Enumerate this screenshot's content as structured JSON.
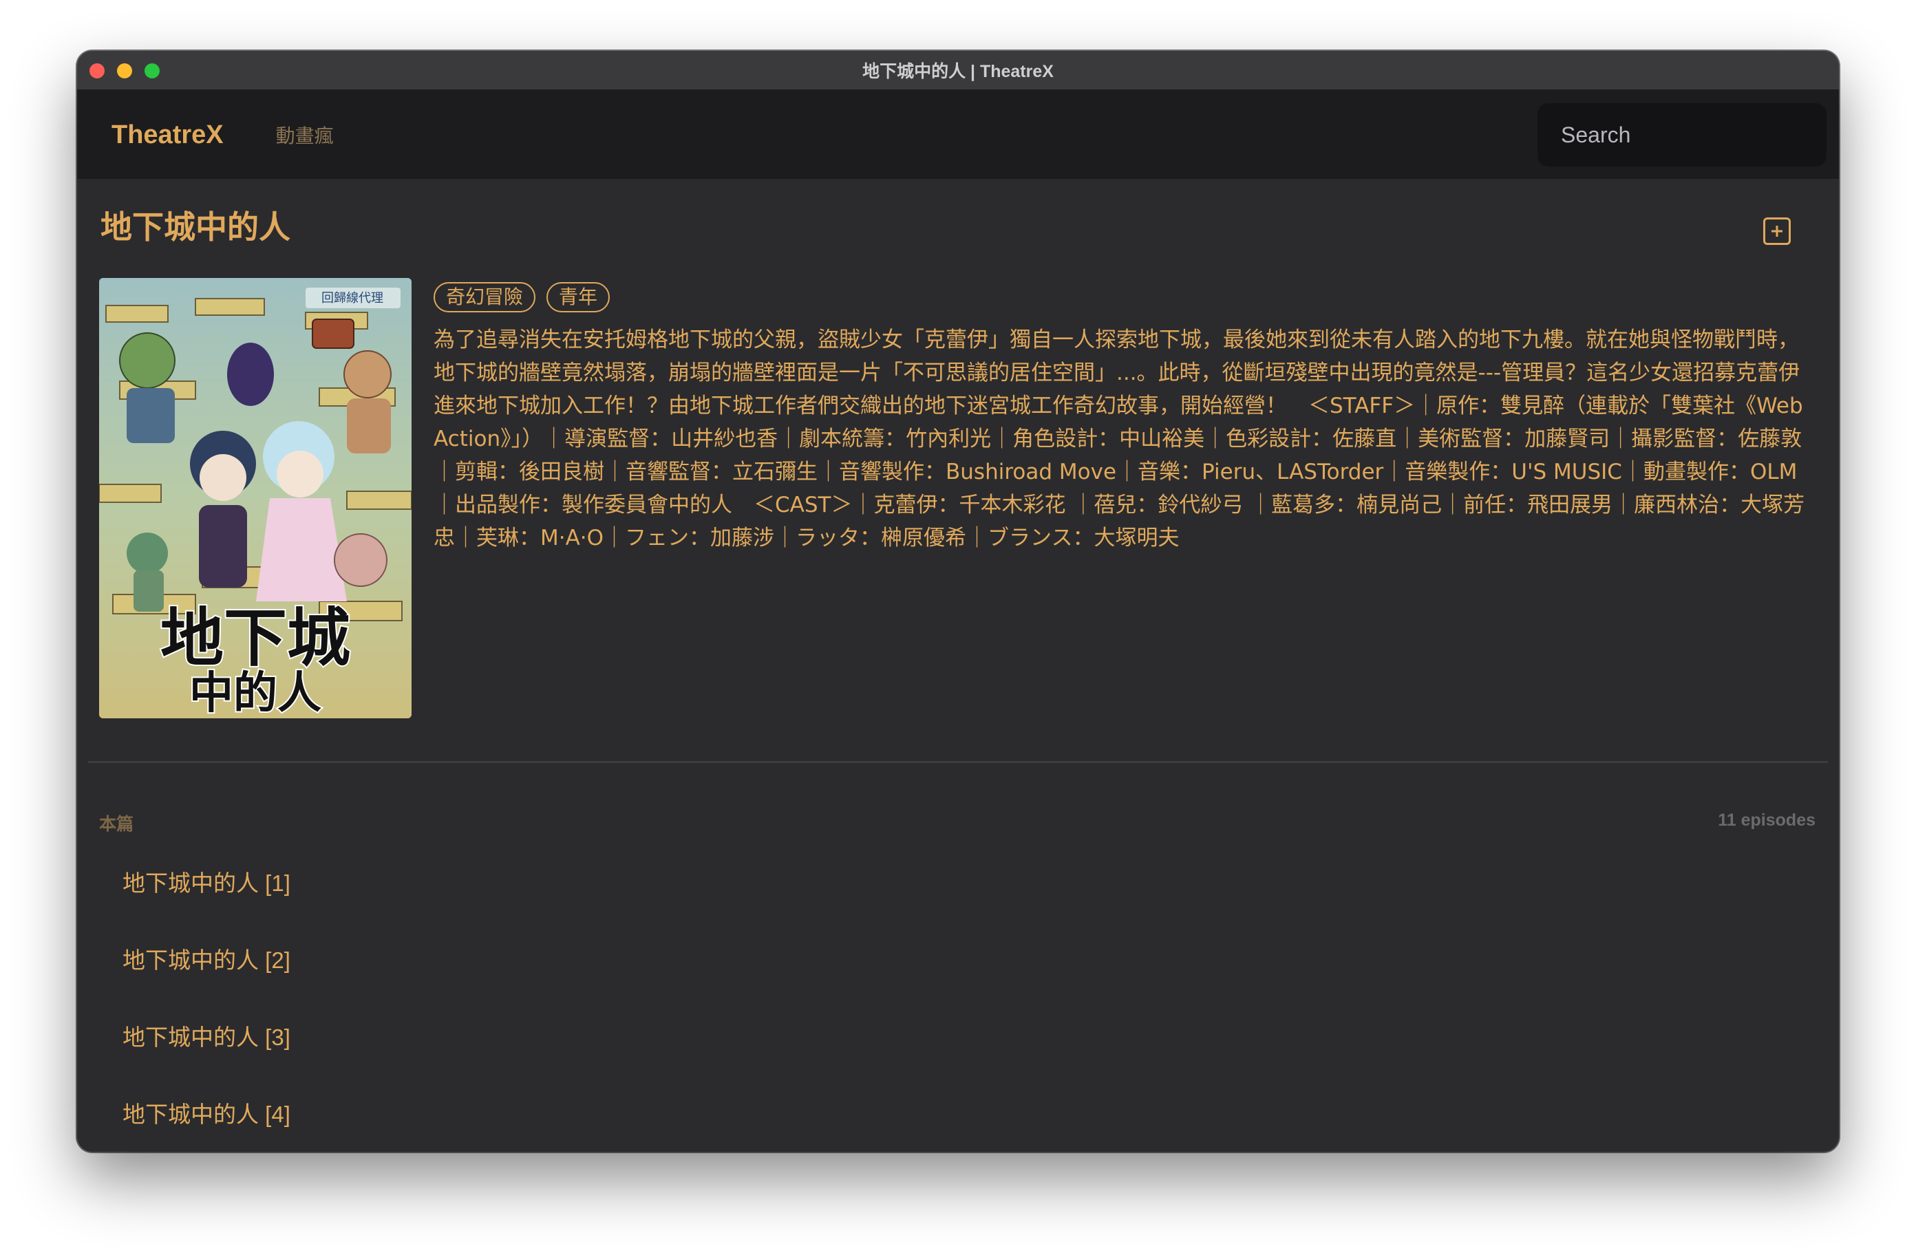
{
  "window": {
    "title": "地下城中的人 | TheatreX"
  },
  "navbar": {
    "brand": "TheatreX",
    "link": "動畫瘋",
    "search_placeholder": "Search"
  },
  "show": {
    "title": "地下城中的人",
    "tags": [
      "奇幻冒險",
      "青年"
    ],
    "description": "為了追尋消失在安托姆格地下城的父親，盜賊少女「克蕾伊」獨自一人探索地下城，最後她來到從未有人踏入的地下九樓。就在她與怪物戰鬥時，地下城的牆壁竟然塌落，崩塌的牆壁裡面是一片「不可思議的居住空間」...。此時，從斷垣殘壁中出現的竟然是---管理員？這名少女還招募克蕾伊進來地下城加入工作！？由地下城工作者們交織出的地下迷宮城工作奇幻故事，開始經營！　＜STAFF＞｜原作：雙見醉（連載於「雙葉社《Web Action》」）｜導演監督：山井紗也香｜劇本統籌：竹內利光｜角色設計：中山裕美｜色彩設計：佐藤直｜美術監督：加藤賢司｜攝影監督：佐藤敦｜剪輯：後田良樹｜音響監督：立石彌生｜音響製作：Bushiroad Move｜音樂：Pieru、LASTorder｜音樂製作：U'S MUSIC｜動畫製作：OLM｜出品製作：製作委員會中的人　＜CAST＞｜克蕾伊：千本木彩花 ｜蓓兒：鈴代紗弓 ｜藍葛多：楠見尚己｜前任：飛田展男｜廉西林治：大塚芳忠｜芙琳：M·A·O｜フェン：加藤涉｜ラッタ：榊原優希｜ブランス：大塚明夫",
    "poster": {
      "title_line1": "地下城",
      "title_line2": "中的人",
      "badge": "回歸線代理"
    }
  },
  "episodes": {
    "section_label": "本篇",
    "count_label": "11 episodes",
    "items": [
      {
        "label": "地下城中的人 [1]"
      },
      {
        "label": "地下城中的人 [2]"
      },
      {
        "label": "地下城中的人 [3]"
      },
      {
        "label": "地下城中的人 [4]"
      }
    ]
  },
  "colors": {
    "accent": "#e0a95b",
    "background": "#2b2b2e",
    "navbar": "#1c1c1e"
  },
  "icons": {
    "add": "plus-square-icon"
  }
}
